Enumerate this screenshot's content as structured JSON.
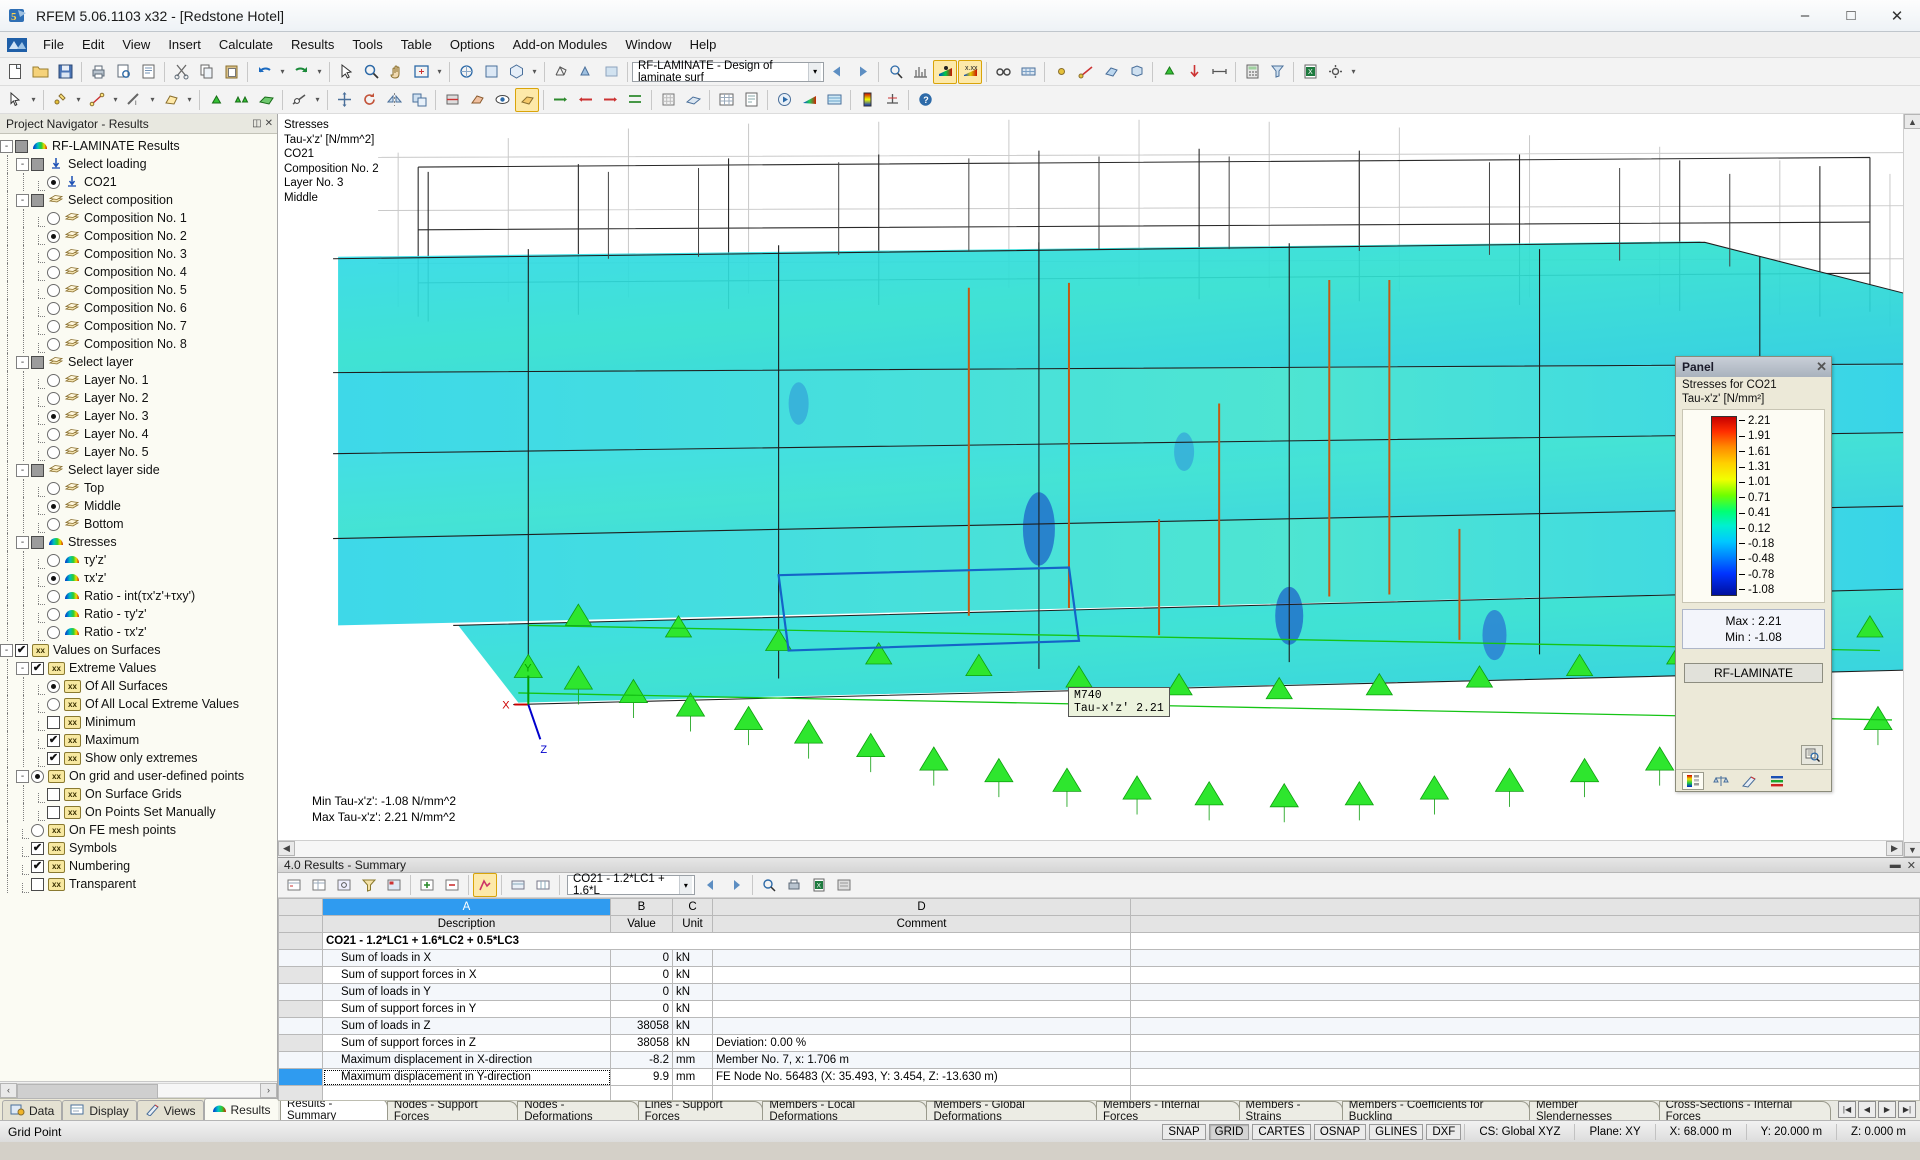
{
  "window": {
    "title": "RFEM 5.06.1103 x32 - [Redstone Hotel]",
    "minimize": "–",
    "maximize": "□",
    "close": "✕"
  },
  "menubar": {
    "items": [
      "File",
      "Edit",
      "View",
      "Insert",
      "Calculate",
      "Results",
      "Tools",
      "Table",
      "Options",
      "Add-on Modules",
      "Window",
      "Help"
    ]
  },
  "toolbar": {
    "module_combo": "RF-LAMINATE - Design of laminate surf",
    "load_case_combo": "CO21 - 1.2*LC1 + 1.6*L"
  },
  "navigator": {
    "header": "Project Navigator - Results",
    "tree": [
      {
        "level": 0,
        "type": "check-gray",
        "label": "RF-LAMINATE Results",
        "icon": "rainbow-icon",
        "expander": "-"
      },
      {
        "level": 1,
        "type": "check-gray",
        "label": "Select loading",
        "icon": "load-icon",
        "expander": "-"
      },
      {
        "level": 2,
        "type": "radio-on",
        "label": "CO21",
        "icon": "load-icon"
      },
      {
        "level": 1,
        "type": "check-gray",
        "label": "Select composition",
        "icon": "layers-icon",
        "expander": "-"
      },
      {
        "level": 2,
        "type": "radio-off",
        "label": "Composition No. 1",
        "icon": "layers-icon"
      },
      {
        "level": 2,
        "type": "radio-on",
        "label": "Composition No. 2",
        "icon": "layers-icon"
      },
      {
        "level": 2,
        "type": "radio-off",
        "label": "Composition No. 3",
        "icon": "layers-icon"
      },
      {
        "level": 2,
        "type": "radio-off",
        "label": "Composition No. 4",
        "icon": "layers-icon"
      },
      {
        "level": 2,
        "type": "radio-off",
        "label": "Composition No. 5",
        "icon": "layers-icon"
      },
      {
        "level": 2,
        "type": "radio-off",
        "label": "Composition No. 6",
        "icon": "layers-icon"
      },
      {
        "level": 2,
        "type": "radio-off",
        "label": "Composition No. 7",
        "icon": "layers-icon"
      },
      {
        "level": 2,
        "type": "radio-off",
        "label": "Composition No. 8",
        "icon": "layers-icon"
      },
      {
        "level": 1,
        "type": "check-gray",
        "label": "Select layer",
        "icon": "layers-icon",
        "expander": "-"
      },
      {
        "level": 2,
        "type": "radio-off",
        "label": "Layer No. 1",
        "icon": "layers-icon"
      },
      {
        "level": 2,
        "type": "radio-off",
        "label": "Layer No. 2",
        "icon": "layers-icon"
      },
      {
        "level": 2,
        "type": "radio-on",
        "label": "Layer No. 3",
        "icon": "layers-icon"
      },
      {
        "level": 2,
        "type": "radio-off",
        "label": "Layer No. 4",
        "icon": "layers-icon"
      },
      {
        "level": 2,
        "type": "radio-off",
        "label": "Layer No. 5",
        "icon": "layers-icon"
      },
      {
        "level": 1,
        "type": "check-gray",
        "label": "Select layer side",
        "icon": "layers-icon",
        "expander": "-"
      },
      {
        "level": 2,
        "type": "radio-off",
        "label": "Top",
        "icon": "layers-icon"
      },
      {
        "level": 2,
        "type": "radio-on",
        "label": "Middle",
        "icon": "layers-icon"
      },
      {
        "level": 2,
        "type": "radio-off",
        "label": "Bottom",
        "icon": "layers-icon"
      },
      {
        "level": 1,
        "type": "check-gray",
        "label": "Stresses",
        "icon": "rainbow-icon",
        "expander": "-"
      },
      {
        "level": 2,
        "type": "radio-off",
        "label": "τy'z'",
        "icon": "rainbow-icon"
      },
      {
        "level": 2,
        "type": "radio-on",
        "label": "τx'z'",
        "icon": "rainbow-icon"
      },
      {
        "level": 2,
        "type": "radio-off",
        "label": "Ratio - int(τx'z'+τxy')",
        "icon": "rainbow-icon"
      },
      {
        "level": 2,
        "type": "radio-off",
        "label": "Ratio - τy'z'",
        "icon": "rainbow-icon"
      },
      {
        "level": 2,
        "type": "radio-off",
        "label": "Ratio - τx'z'",
        "icon": "rainbow-icon"
      },
      {
        "level": 0,
        "type": "check-on",
        "label": "Values on Surfaces",
        "icon": "xx-icon",
        "expander": "-"
      },
      {
        "level": 1,
        "type": "check-on",
        "label": "Extreme Values",
        "icon": "xx-icon",
        "expander": "-"
      },
      {
        "level": 2,
        "type": "radio-on",
        "label": "Of All Surfaces",
        "icon": "xx-icon"
      },
      {
        "level": 2,
        "type": "radio-off",
        "label": "Of All Local Extreme Values",
        "icon": "xx-icon"
      },
      {
        "level": 2,
        "type": "check-off",
        "label": "Minimum",
        "icon": "xx-icon"
      },
      {
        "level": 2,
        "type": "check-on",
        "label": "Maximum",
        "icon": "xx-icon"
      },
      {
        "level": 2,
        "type": "check-on",
        "label": "Show only extremes",
        "icon": "xx-icon"
      },
      {
        "level": 1,
        "type": "radio-on",
        "label": "On grid and user-defined points",
        "icon": "xx-icon",
        "expander": "-"
      },
      {
        "level": 2,
        "type": "check-off",
        "label": "On Surface Grids",
        "icon": "xx-icon"
      },
      {
        "level": 2,
        "type": "check-off",
        "label": "On Points Set Manually",
        "icon": "xx-icon"
      },
      {
        "level": 1,
        "type": "radio-off",
        "label": "On FE mesh points",
        "icon": "xx-icon"
      },
      {
        "level": 1,
        "type": "check-on",
        "label": "Symbols",
        "icon": "xx-icon"
      },
      {
        "level": 1,
        "type": "check-on",
        "label": "Numbering",
        "icon": "xx-icon"
      },
      {
        "level": 1,
        "type": "check-off",
        "label": "Transparent",
        "icon": "xx-icon"
      }
    ],
    "tabs": [
      {
        "label": "Data",
        "icon": "data-icon",
        "active": false
      },
      {
        "label": "Display",
        "icon": "display-icon",
        "active": false
      },
      {
        "label": "Views",
        "icon": "views-icon",
        "active": false
      },
      {
        "label": "Results",
        "icon": "results-icon",
        "active": true
      }
    ]
  },
  "viewport": {
    "legend_lines": [
      "Stresses",
      "Tau-x'z' [N/mm^2]",
      "CO21",
      "Composition No. 2",
      "Layer No. 3",
      "Middle"
    ],
    "min_label": "Min Tau-x'z': -1.08 N/mm^2",
    "max_label": "Max Tau-x'z': 2.21 N/mm^2",
    "tooltip": {
      "node": "M740",
      "value": "Tau-x'z'   2.21"
    },
    "axes": {
      "x": "X",
      "y": "Y",
      "z": "Z"
    }
  },
  "panel": {
    "title": "Panel",
    "close": "✕",
    "subtitle1": "Stresses for CO21",
    "subtitle2": "Tau-x'z' [N/mm²]",
    "scale_values": [
      "2.21",
      "1.91",
      "1.61",
      "1.31",
      "1.01",
      "0.71",
      "0.41",
      "0.12",
      "-0.18",
      "-0.48",
      "-0.78",
      "-1.08"
    ],
    "max_label": "Max :",
    "max_value": "2.21",
    "min_label": "Min  :",
    "min_value": "-1.08",
    "button": "RF-LAMINATE",
    "tabs": [
      "color-scale-tab",
      "factors-tab",
      "filter-tab",
      "display-tab"
    ]
  },
  "table": {
    "title": "4.0 Results - Summary",
    "load_case": "CO21 - 1.2*LC1 + 1.6*L",
    "column_letters": [
      "A",
      "B",
      "C",
      "D"
    ],
    "headers": [
      "Description",
      "Value",
      "Unit",
      "Comment"
    ],
    "group_row": "CO21 - 1.2*LC1 + 1.6*LC2 + 0.5*LC3",
    "rows": [
      {
        "description": "Sum of loads in X",
        "value": "0",
        "unit": "kN",
        "comment": ""
      },
      {
        "description": "Sum of support forces in X",
        "value": "0",
        "unit": "kN",
        "comment": ""
      },
      {
        "description": "Sum of loads in Y",
        "value": "0",
        "unit": "kN",
        "comment": ""
      },
      {
        "description": "Sum of support forces in Y",
        "value": "0",
        "unit": "kN",
        "comment": ""
      },
      {
        "description": "Sum of loads in Z",
        "value": "38058",
        "unit": "kN",
        "comment": ""
      },
      {
        "description": "Sum of support forces in Z",
        "value": "38058",
        "unit": "kN",
        "comment": "Deviation:  0.00 %"
      },
      {
        "description": "Maximum displacement in X-direction",
        "value": "-8.2",
        "unit": "mm",
        "comment": "Member No. 7, x: 1.706 m"
      },
      {
        "description": "Maximum displacement in Y-direction",
        "value": "9.9",
        "unit": "mm",
        "comment": "FE Node No. 56483  (X: 35.493,  Y: 3.454,  Z: -13.630 m)"
      }
    ],
    "tabs": [
      "Results - Summary",
      "Nodes - Support Forces",
      "Nodes - Deformations",
      "Lines - Support Forces",
      "Members - Local Deformations",
      "Members - Global Deformations",
      "Members - Internal Forces",
      "Members - Strains",
      "Members - Coefficients for Buckling",
      "Member Slendernesses",
      "Cross-Sections - Internal Forces"
    ],
    "active_tab": "Results - Summary"
  },
  "statusbar": {
    "hint": "Grid Point",
    "toggles": [
      {
        "label": "SNAP",
        "on": false
      },
      {
        "label": "GRID",
        "on": true
      },
      {
        "label": "CARTES",
        "on": false
      },
      {
        "label": "OSNAP",
        "on": false
      },
      {
        "label": "GLINES",
        "on": false
      },
      {
        "label": "DXF",
        "on": false
      }
    ],
    "cs": "CS: Global XYZ",
    "plane": "Plane: XY",
    "x": "X:  68.000 m",
    "y": "Y:  20.000 m",
    "z": "Z:  0.000 m"
  },
  "colors": {
    "accent": "#2f9bf0",
    "panel_bg": "#ece9d8",
    "navigator_bg": "#fbfbf3",
    "surface_cyan": "#2ad4d4",
    "support_green": "#35e035",
    "member_orange": "#c86414"
  }
}
